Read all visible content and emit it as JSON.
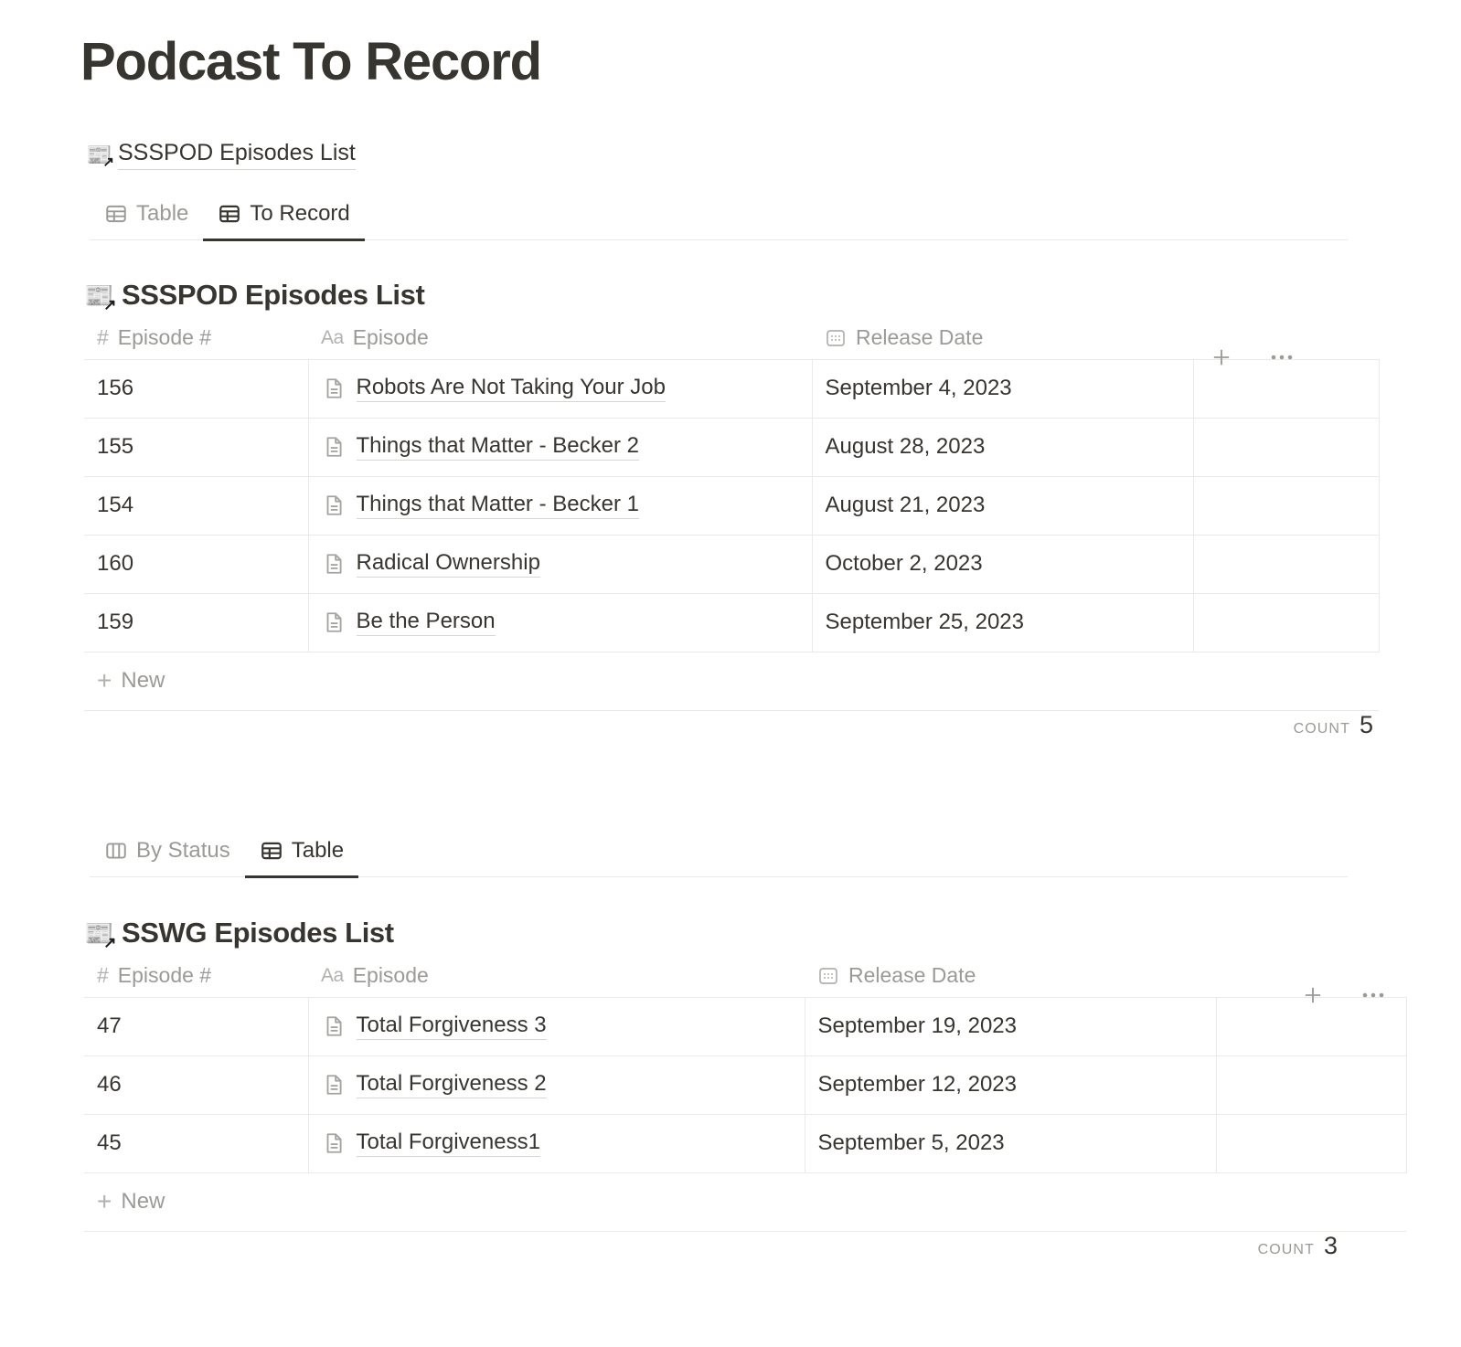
{
  "page": {
    "title": "Podcast To Record",
    "inline_link": {
      "icon": "newspaper-link-icon",
      "label": "SSSPOD Episodes List"
    }
  },
  "view_tabs_top": {
    "tabs": [
      {
        "label": "Table",
        "icon": "table-view-icon",
        "active": false
      },
      {
        "label": "To Record",
        "icon": "table-view-icon",
        "active": true
      }
    ]
  },
  "view_tabs_bottom": {
    "tabs": [
      {
        "label": "By Status",
        "icon": "board-view-icon",
        "active": false
      },
      {
        "label": "Table",
        "icon": "table-view-icon",
        "active": true
      }
    ]
  },
  "database_1": {
    "title": "SSSPOD Episodes List",
    "columns": [
      {
        "label": "Episode #",
        "icon": "number-property-icon",
        "glyph": "#"
      },
      {
        "label": "Episode",
        "icon": "text-property-icon",
        "glyph": "Aa"
      },
      {
        "label": "Release Date",
        "icon": "date-property-icon",
        "glyph": "calendar"
      }
    ],
    "rows": [
      {
        "episode_number": "156",
        "episode": "Robots Are Not Taking Your Job",
        "release_date": "September 4, 2023"
      },
      {
        "episode_number": "155",
        "episode": "Things that Matter - Becker 2",
        "release_date": "August 28, 2023"
      },
      {
        "episode_number": "154",
        "episode": "Things that Matter - Becker 1",
        "release_date": "August 21, 2023"
      },
      {
        "episode_number": "160",
        "episode": "Radical Ownership",
        "release_date": "October 2, 2023"
      },
      {
        "episode_number": "159",
        "episode": "Be the Person",
        "release_date": "September 25, 2023"
      }
    ],
    "new_row_label": "New",
    "count_label": "COUNT",
    "count_value": "5",
    "add_column_label": "+",
    "more_label": "•••"
  },
  "database_2": {
    "title": "SSWG Episodes List",
    "columns": [
      {
        "label": "Episode #",
        "icon": "number-property-icon",
        "glyph": "#"
      },
      {
        "label": "Episode",
        "icon": "text-property-icon",
        "glyph": "Aa"
      },
      {
        "label": "Release Date",
        "icon": "date-property-icon",
        "glyph": "calendar"
      }
    ],
    "rows": [
      {
        "episode_number": "47",
        "episode": "Total Forgiveness 3",
        "release_date": "September 19, 2023"
      },
      {
        "episode_number": "46",
        "episode": "Total Forgiveness 2",
        "release_date": "September 12, 2023"
      },
      {
        "episode_number": "45",
        "episode": "Total Forgiveness1",
        "release_date": "September 5, 2023"
      }
    ],
    "new_row_label": "New",
    "count_label": "COUNT",
    "count_value": "3",
    "add_column_label": "+",
    "more_label": "•••"
  },
  "colors": {
    "text": "#37352f",
    "muted": "#9b9a97",
    "border": "#eceae6",
    "underline": "#d8d6d1"
  }
}
